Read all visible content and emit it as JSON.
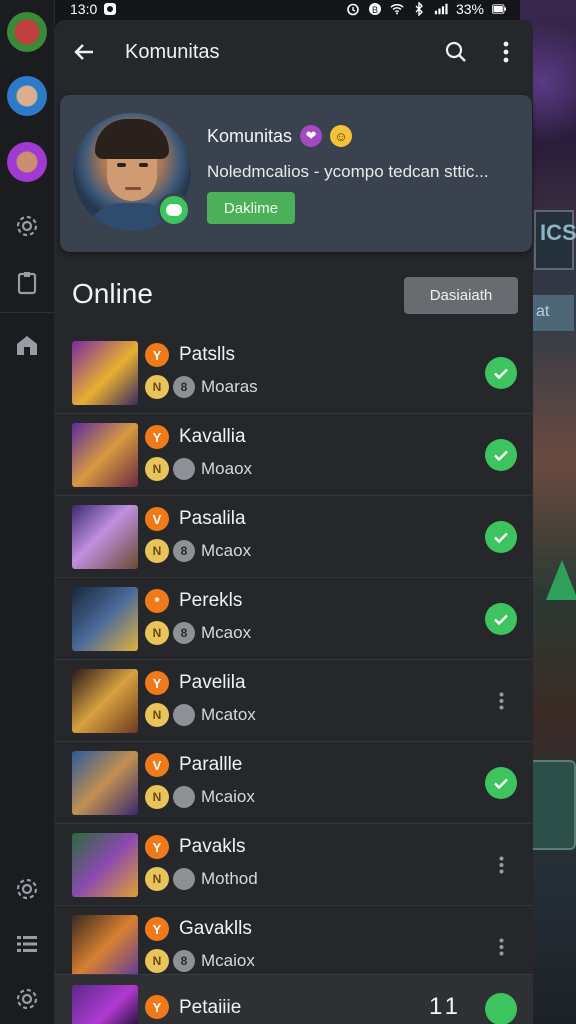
{
  "status_bar": {
    "time": "13:0",
    "battery": "33%"
  },
  "appbar": {
    "title": "Komunitas"
  },
  "community": {
    "title": "Komunitas",
    "description": "Noledmcalios - ycompo tedcan sttic...",
    "button_label": "Daklime"
  },
  "online": {
    "title": "Online",
    "button_label": "Dasiaiath"
  },
  "members": [
    {
      "name": "Patslls",
      "game_badge": "Y",
      "coin_badge": "N",
      "mini_badge": "8",
      "sub": "Moaras",
      "status": "check"
    },
    {
      "name": "Kavallia",
      "game_badge": "Y",
      "coin_badge": "N",
      "mini_badge": "",
      "sub": "Moaox",
      "status": "check"
    },
    {
      "name": "Pasalila",
      "game_badge": "V",
      "coin_badge": "N",
      "mini_badge": "8",
      "sub": "Mcaox",
      "status": "check"
    },
    {
      "name": "Perekls",
      "game_badge": "*",
      "coin_badge": "N",
      "mini_badge": "8",
      "sub": "Mcaox",
      "status": "check"
    },
    {
      "name": "Pavelila",
      "game_badge": "Y",
      "coin_badge": "N",
      "mini_badge": "",
      "sub": "Mcatox",
      "status": "menu"
    },
    {
      "name": "Parallle",
      "game_badge": "V",
      "coin_badge": "N",
      "mini_badge": "",
      "sub": "Mcaiox",
      "status": "check"
    },
    {
      "name": "Pavakls",
      "game_badge": "Y",
      "coin_badge": "N",
      "mini_badge": "",
      "sub": "Mothod",
      "status": "menu"
    },
    {
      "name": "Gavaklls",
      "game_badge": "Y",
      "coin_badge": "N",
      "mini_badge": "8",
      "sub": "Mcaiox",
      "status": "menu"
    }
  ],
  "bottom_bar": {
    "name": "Petaiiie",
    "game_badge": "Y",
    "count": "11"
  },
  "colors": {
    "panel": "#26272b",
    "card": "#3a4250",
    "accent_green": "#3ec45e",
    "game_orange": "#f07a1a",
    "coin_gold": "#e8c45a"
  }
}
